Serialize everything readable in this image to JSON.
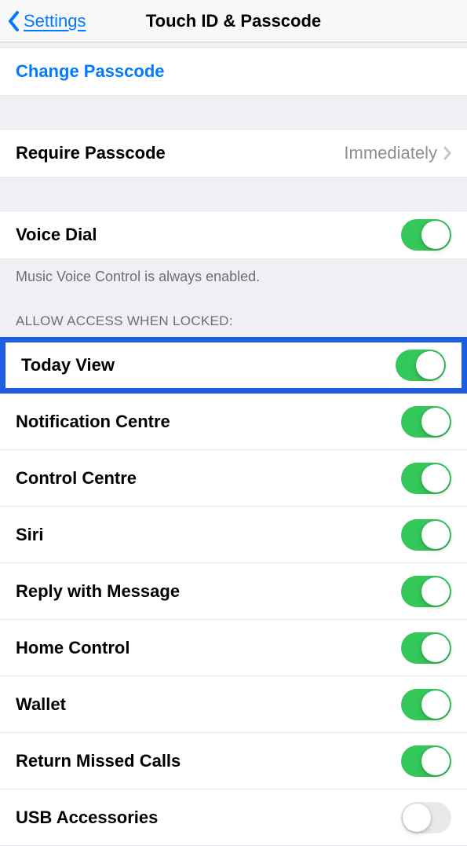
{
  "nav": {
    "back_label": "Settings",
    "title": "Touch ID & Passcode"
  },
  "rows": {
    "change_passcode": "Change Passcode",
    "require_passcode": {
      "label": "Require Passcode",
      "value": "Immediately"
    },
    "voice_dial": "Voice Dial",
    "voice_dial_note": "Music Voice Control is always enabled."
  },
  "allow_access": {
    "header": "ALLOW ACCESS WHEN LOCKED:",
    "items": [
      {
        "label": "Today View",
        "on": true,
        "highlighted": true
      },
      {
        "label": "Notification Centre",
        "on": true
      },
      {
        "label": "Control Centre",
        "on": true
      },
      {
        "label": "Siri",
        "on": true
      },
      {
        "label": "Reply with Message",
        "on": true
      },
      {
        "label": "Home Control",
        "on": true
      },
      {
        "label": "Wallet",
        "on": true
      },
      {
        "label": "Return Missed Calls",
        "on": true
      },
      {
        "label": "USB Accessories",
        "on": false
      }
    ]
  }
}
